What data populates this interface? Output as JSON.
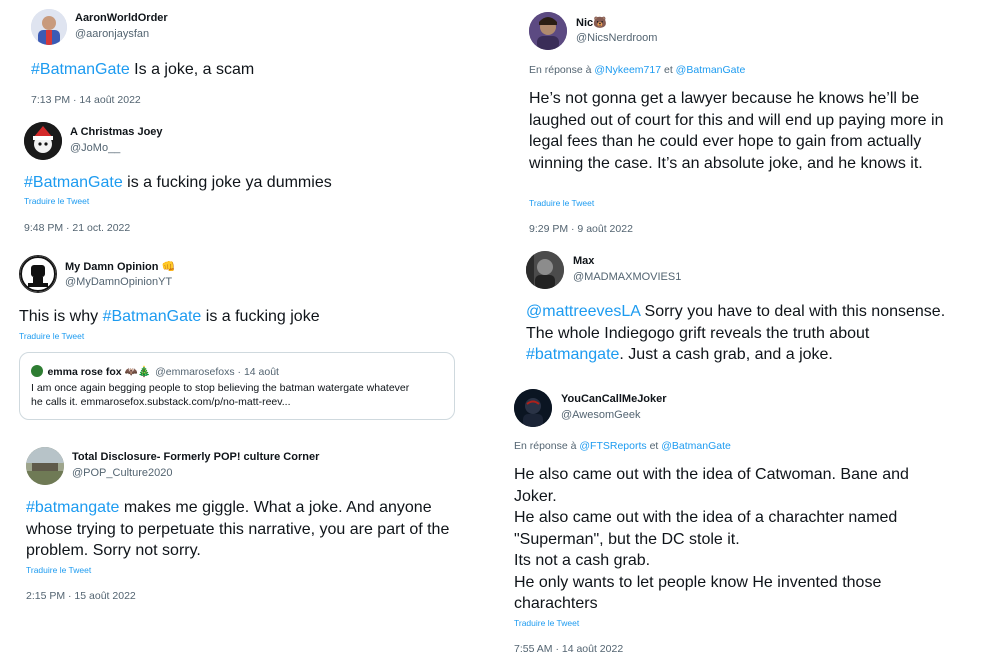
{
  "tweets": [
    {
      "name": "AaronWorldOrder",
      "handle": "@aaronjaysfan",
      "body": {
        "tag": "#BatmanGate",
        "text": " Is a joke, a scam"
      },
      "time": "7:13 PM · 14 août 2022"
    },
    {
      "name": "A Christmas Joey",
      "handle": "@JoMo__",
      "body": {
        "tag": "#BatmanGate",
        "text": " is a fucking joke ya dummies"
      },
      "translate": "Traduire le Tweet",
      "time": "9:48 PM · 21 oct. 2022"
    },
    {
      "name": "My Damn Opinion 👊",
      "handle": "@MyDamnOpinionYT",
      "body": {
        "pre": "This is why ",
        "tag": "#BatmanGate",
        "text": " is a fucking joke"
      },
      "translate": "Traduire le Tweet",
      "quote": {
        "name": "emma rose fox 🦇🎄",
        "handle": "@emmarosefoxs · 14 août",
        "text1": "I am once again begging people to stop believing the batman watergate whatever",
        "text2": "he calls it. emmarosefox.substack.com/p/no-matt-reev..."
      }
    },
    {
      "name": "Total Disclosure- Formerly POP! culture Corner",
      "handle": "@POP_Culture2020",
      "body": {
        "tag": "#batmangate",
        "text": " makes me giggle. What a joke. And anyone whose trying to perpetuate this narrative, you are part of the problem. Sorry not sorry."
      },
      "translate": "Traduire le Tweet",
      "time": "2:15 PM · 15 août 2022"
    },
    {
      "name": "Nic🐻",
      "handle": "@NicsNerdroom",
      "reply": {
        "prefix": "En réponse à ",
        "m1": "@Nykeem717",
        "sep": " et ",
        "m2": "@BatmanGate"
      },
      "body": {
        "text": "He’s not gonna get a lawyer because he knows he’ll be laughed out of court for this and will end up paying more in legal fees than he could ever hope to gain from actually winning the case. It’s an absolute joke, and he knows it."
      },
      "translate": "Traduire le Tweet",
      "time": "9:29 PM · 9 août 2022"
    },
    {
      "name": "Max",
      "handle": "@MADMAXMOVIES1",
      "body": {
        "ment": "@mattreevesLA",
        "text1": " Sorry you have to deal with this nonsense. The whole Indiegogo grift reveals the truth about ",
        "tag": "#batmangate",
        "text2": ". Just a cash grab, and a joke."
      }
    },
    {
      "name": "YouCanCallMeJoker",
      "handle": "@AwesomGeek",
      "reply": {
        "prefix": "En réponse à ",
        "m1": "@FTSReports",
        "sep": " et ",
        "m2": "@BatmanGate"
      },
      "body": {
        "l1": "He also came out with the idea of Catwoman. Bane and Joker.",
        "l2": "He also came out with the idea of a charachter named \"Superman\", but the DC stole it.",
        "l3": "Its not a cash grab.",
        "l4": "He only wants to let people know He invented those charachters"
      },
      "translate": "Traduire le Tweet",
      "time": "7:55 AM · 14 août 2022"
    }
  ],
  "colors": {
    "link": "#1d9bf0",
    "secondary": "#536471",
    "text": "#0f1419",
    "border": "#cfd9de"
  }
}
